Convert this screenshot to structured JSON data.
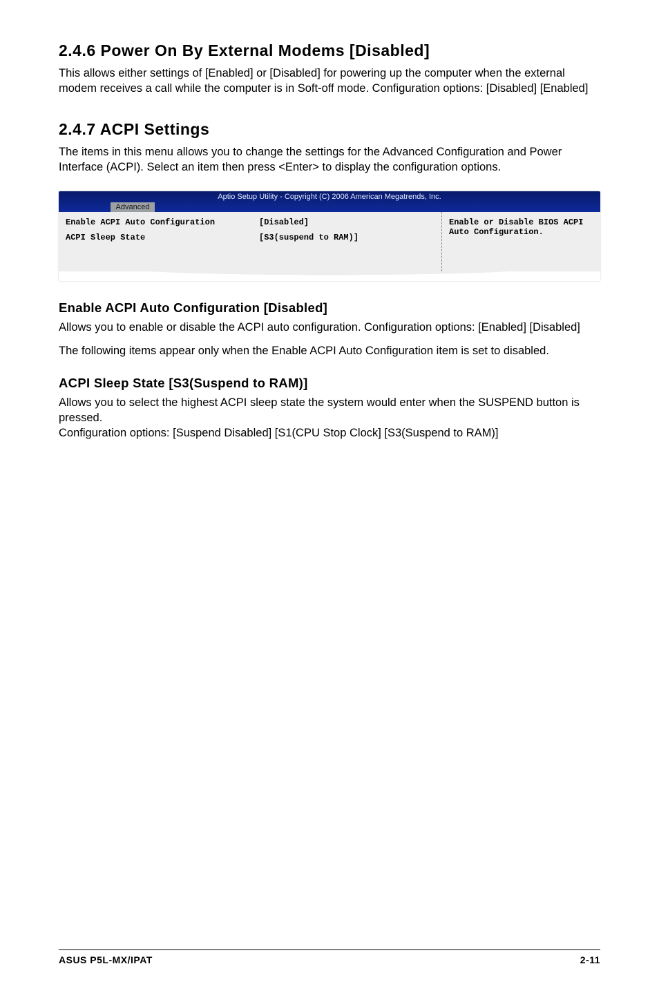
{
  "section246": {
    "heading": "2.4.6   Power On By External Modems [Disabled]",
    "body": "This allows either settings of [Enabled] or [Disabled] for powering up the computer when the external modem receives a call while the computer is in Soft-off mode. Configuration options: [Disabled] [Enabled]"
  },
  "section247": {
    "heading": "2.4.7   ACPI Settings",
    "body": "The items in this menu allows you to change the settings for the Advanced Configuration and Power Interface (ACPI). Select an item then press <Enter> to display the configuration options."
  },
  "bios": {
    "header_text": "Aptio Setup Utility - Copyright (C) 2006 American Megatrends, Inc.",
    "tab": "Advanced",
    "rows": [
      {
        "label": "Enable ACPI Auto Configuration",
        "value": "[Disabled]"
      },
      {
        "label": "ACPI Sleep State",
        "value": "[S3(suspend to RAM)]"
      }
    ],
    "help": "Enable or Disable BIOS ACPI Auto Configuration."
  },
  "enable_acpi": {
    "heading": "Enable ACPI Auto Configuration [Disabled]",
    "body1": "Allows you to enable or disable the ACPI auto configuration. Configuration options: [Enabled] [Disabled]",
    "body2": "The following items appear only when the Enable ACPI Auto Configuration item is set to disabled."
  },
  "sleep_state": {
    "heading": "ACPI Sleep State [S3(Suspend to RAM)]",
    "body": "Allows you to select the highest ACPI sleep state the system would enter when the SUSPEND button is pressed.\nConfiguration options: [Suspend Disabled] [S1(CPU Stop Clock] [S3(Suspend to RAM)]"
  },
  "footer": {
    "left": "ASUS P5L-MX/IPAT",
    "right": "2-11"
  }
}
